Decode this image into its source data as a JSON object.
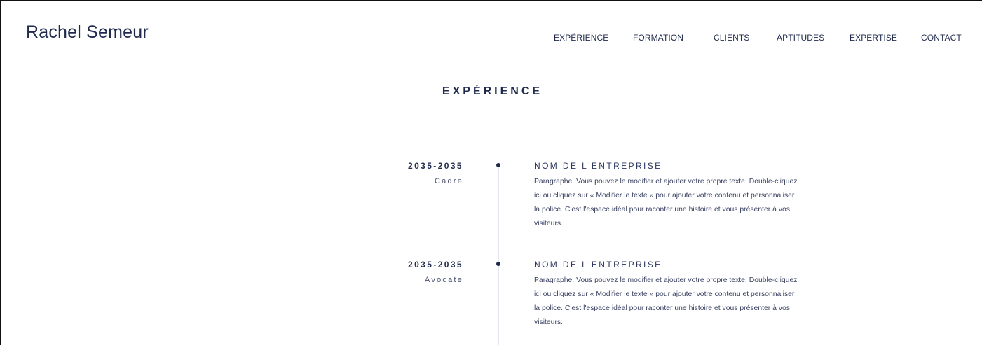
{
  "header": {
    "site_name": "Rachel Semeur",
    "nav": [
      "EXPÉRIENCE",
      "FORMATION",
      "CLIENTS",
      "APTITUDES",
      "EXPERTISE",
      "CONTACT"
    ]
  },
  "section": {
    "title": "EXPÉRIENCE"
  },
  "entries": [
    {
      "dates": "2035-2035",
      "role": "Cadre",
      "company": "NOM DE L'ENTREPRISE",
      "paragraph": "Paragraphe. Vous pouvez le modifier et ajouter votre propre texte. Double-cliquez ici ou cliquez sur « Modifier le texte » pour ajouter votre contenu et personnaliser la police. C'est l'espace idéal pour raconter une histoire et vous présenter à vos visiteurs."
    },
    {
      "dates": "2035-2035",
      "role": "Avocate",
      "company": "NOM DE L'ENTREPRISE",
      "paragraph": "Paragraphe. Vous pouvez le modifier et ajouter votre propre texte. Double-cliquez ici ou cliquez sur « Modifier le texte » pour ajouter votre contenu et personnaliser la police. C'est l'espace idéal pour raconter une histoire et vous présenter à vos visiteurs."
    }
  ],
  "colors": {
    "text": "#1f2a4d",
    "background": "#ffffff",
    "divider": "#e8e8ee"
  }
}
